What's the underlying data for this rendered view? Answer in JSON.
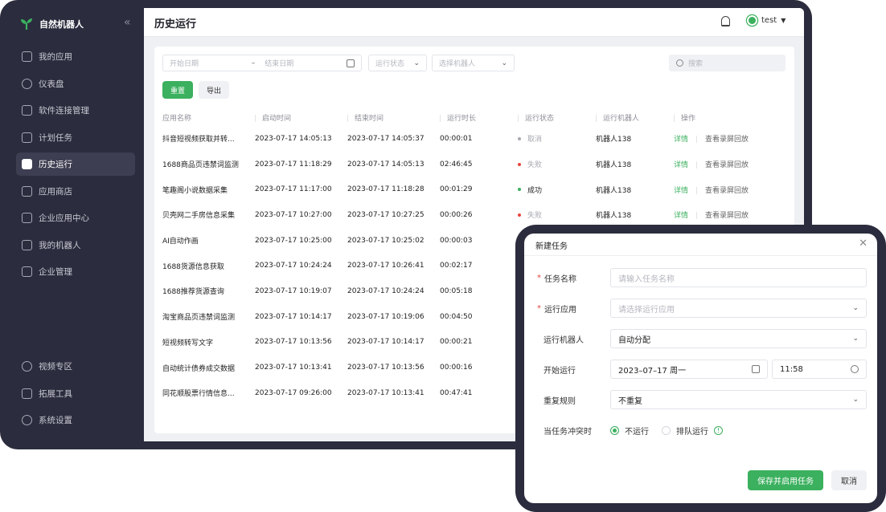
{
  "brand": {
    "name": "自然机器人",
    "logo_icon": "sprout-icon",
    "accent": "#3bb05e"
  },
  "sidebar": {
    "items": [
      {
        "label": "我的应用",
        "icon": "folder-icon"
      },
      {
        "label": "仪表盘",
        "icon": "dashboard-icon"
      },
      {
        "label": "软件连接管理",
        "icon": "link-icon"
      },
      {
        "label": "计划任务",
        "icon": "calendar-icon"
      },
      {
        "label": "历史运行",
        "icon": "document-icon",
        "active": true
      },
      {
        "label": "应用商店",
        "icon": "store-icon"
      },
      {
        "label": "企业应用中心",
        "icon": "building-icon"
      },
      {
        "label": "我的机器人",
        "icon": "robot-icon"
      },
      {
        "label": "企业管理",
        "icon": "org-icon"
      }
    ],
    "bottom_items": [
      {
        "label": "视频专区",
        "icon": "play-icon"
      },
      {
        "label": "拓展工具",
        "icon": "puzzle-icon"
      },
      {
        "label": "系统设置",
        "icon": "gear-icon"
      }
    ]
  },
  "header": {
    "title": "历史运行",
    "user": "test"
  },
  "filters": {
    "start_date_placeholder": "开始日期",
    "range_sep": "–",
    "end_date_placeholder": "结束日期",
    "status_placeholder": "运行状态",
    "robot_placeholder": "选择机器人",
    "search_placeholder": "搜索",
    "reset_label": "重置",
    "export_label": "导出"
  },
  "table": {
    "columns": [
      "应用名称",
      "启动时间",
      "结束时间",
      "运行时长",
      "运行状态",
      "运行机器人",
      "操作"
    ],
    "detail_label": "详情",
    "replay_label": "查看录屏回放",
    "rows": [
      {
        "name": "抖音短视频获取并转...",
        "start": "2023-07-17 14:05:13",
        "end": "2023-07-17 14:05:37",
        "duration": "00:00:01",
        "status": "取消",
        "status_kind": "cancel",
        "robot": "机器人138",
        "ops": true
      },
      {
        "name": "1688商品页违禁词监测",
        "start": "2023-07-17 11:18:29",
        "end": "2023-07-17 14:05:13",
        "duration": "02:46:45",
        "status": "失败",
        "status_kind": "fail",
        "robot": "机器人138",
        "ops": true
      },
      {
        "name": "笔趣阁小说数据采集",
        "start": "2023-07-17 11:17:00",
        "end": "2023-07-17 11:18:28",
        "duration": "00:01:29",
        "status": "成功",
        "status_kind": "ok",
        "robot": "机器人138",
        "ops": true
      },
      {
        "name": "贝壳网二手房信息采集",
        "start": "2023-07-17 10:27:00",
        "end": "2023-07-17 10:27:25",
        "duration": "00:00:26",
        "status": "失败",
        "status_kind": "fail",
        "robot": "机器人138",
        "ops": true
      },
      {
        "name": "AI自动作画",
        "start": "2023-07-17 10:25:00",
        "end": "2023-07-17 10:25:02",
        "duration": "00:00:03",
        "status": "",
        "status_kind": "",
        "robot": "",
        "ops": false
      },
      {
        "name": "1688货源信息获取",
        "start": "2023-07-17 10:24:24",
        "end": "2023-07-17 10:26:41",
        "duration": "00:02:17",
        "status": "",
        "status_kind": "",
        "robot": "",
        "ops": false
      },
      {
        "name": "1688推荐货源查询",
        "start": "2023-07-17 10:19:07",
        "end": "2023-07-17 10:24:24",
        "duration": "00:05:18",
        "status": "",
        "status_kind": "",
        "robot": "",
        "ops": false
      },
      {
        "name": "淘宝商品页违禁词监测",
        "start": "2023-07-17 10:14:17",
        "end": "2023-07-17 10:19:06",
        "duration": "00:04:50",
        "status": "",
        "status_kind": "",
        "robot": "",
        "ops": false
      },
      {
        "name": "短视频转写文字",
        "start": "2023-07-17 10:13:56",
        "end": "2023-07-17 10:14:17",
        "duration": "00:00:21",
        "status": "",
        "status_kind": "",
        "robot": "",
        "ops": false
      },
      {
        "name": "自动统计债券成交数据",
        "start": "2023-07-17 10:13:41",
        "end": "2023-07-17 10:13:56",
        "duration": "00:00:16",
        "status": "",
        "status_kind": "",
        "robot": "",
        "ops": false
      },
      {
        "name": "同花顺股票行情信息...",
        "start": "2023-07-17 09:26:00",
        "end": "2023-07-17 10:13:41",
        "duration": "00:47:41",
        "status": "",
        "status_kind": "",
        "robot": "",
        "ops": false
      }
    ]
  },
  "modal": {
    "title": "新建任务",
    "task_name_label": "任务名称",
    "task_name_placeholder": "请输入任务名称",
    "app_label": "运行应用",
    "app_placeholder": "请选择运行应用",
    "robot_label": "运行机器人",
    "robot_value": "自动分配",
    "start_label": "开始运行",
    "start_date": "2023–07–17 周一",
    "start_time": "11:58",
    "repeat_label": "重复规则",
    "repeat_value": "不重复",
    "conflict_label": "当任务冲突时",
    "conflict_options": [
      "不运行",
      "排队运行"
    ],
    "conflict_selected": 0,
    "save_label": "保存并启用任务",
    "cancel_label": "取消"
  }
}
